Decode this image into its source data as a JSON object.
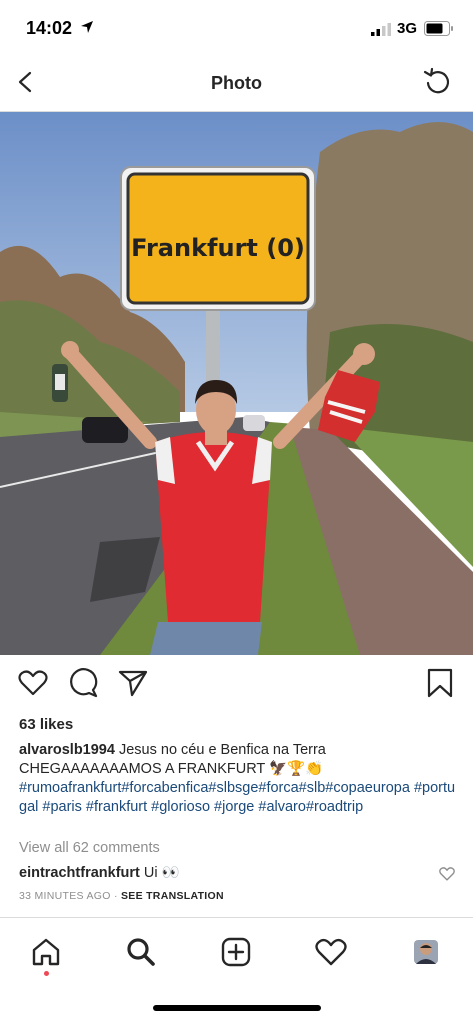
{
  "status_bar": {
    "time": "14:02",
    "network": "3G"
  },
  "header": {
    "title": "Photo"
  },
  "post": {
    "sign_text": "Frankfurt (0)",
    "likes": "63 likes",
    "caption_user": "alvaroslb1994",
    "caption_line1": "Jesus no céu e Benfica na Terra",
    "caption_line2": "CHEGAAAAAAAMOS A FRANKFURT 🦅🏆👏",
    "caption_tags": "#rumoafrankfurt#forcabenfica#slbsge#forca#slb#copaeuropa #portugal #paris #frankfurt #glorioso #jorge #alvaro#roadtrip",
    "view_all": "View all 62 comments",
    "comment_user": "eintrachtfrankfurt",
    "comment_text": "Ui 👀",
    "time_ago": "33 MINUTES AGO",
    "separator": " · ",
    "see_translation": "SEE TRANSLATION"
  },
  "colors": {
    "link": "#1b4a7a",
    "notification": "#ed4956",
    "sign_yellow": "#f4b21b"
  },
  "icons": {
    "actions": [
      "heart-icon",
      "comment-icon",
      "share-icon",
      "bookmark-icon"
    ],
    "tabs": [
      "home-icon",
      "search-icon",
      "add-icon",
      "activity-icon",
      "profile-avatar"
    ]
  }
}
